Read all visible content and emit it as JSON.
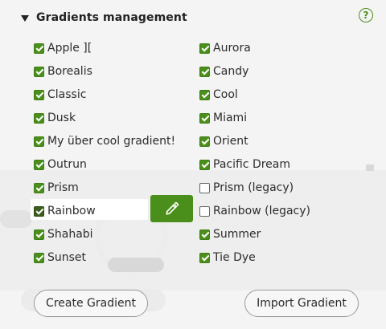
{
  "header": {
    "title": "Gradients management",
    "help_label": "?"
  },
  "gradients_left": [
    {
      "label": "Apple ][",
      "checked": true
    },
    {
      "label": "Borealis",
      "checked": true
    },
    {
      "label": "Classic",
      "checked": true
    },
    {
      "label": "Dusk",
      "checked": true
    },
    {
      "label": "My über cool gradient!",
      "checked": true
    },
    {
      "label": "Outrun",
      "checked": true
    },
    {
      "label": "Prism",
      "checked": true
    },
    {
      "label": "Rainbow",
      "checked": true,
      "selected": true
    },
    {
      "label": "Shahabi",
      "checked": true
    },
    {
      "label": "Sunset",
      "checked": true
    }
  ],
  "gradients_right": [
    {
      "label": "Aurora",
      "checked": true
    },
    {
      "label": "Candy",
      "checked": true
    },
    {
      "label": "Cool",
      "checked": true
    },
    {
      "label": "Miami",
      "checked": true
    },
    {
      "label": "Orient",
      "checked": true
    },
    {
      "label": "Pacific Dream",
      "checked": true
    },
    {
      "label": "Prism (legacy)",
      "checked": false
    },
    {
      "label": "Rainbow (legacy)",
      "checked": false
    },
    {
      "label": "Summer",
      "checked": true
    },
    {
      "label": "Tie Dye",
      "checked": true
    }
  ],
  "actions": {
    "create_label": "Create Gradient",
    "import_label": "Import Gradient"
  },
  "icons": {
    "edit": "pencil-icon",
    "help": "help-icon",
    "collapse": "caret-down-icon"
  },
  "colors": {
    "accent": "#4a8f1b",
    "background": "#f4f4f4"
  }
}
